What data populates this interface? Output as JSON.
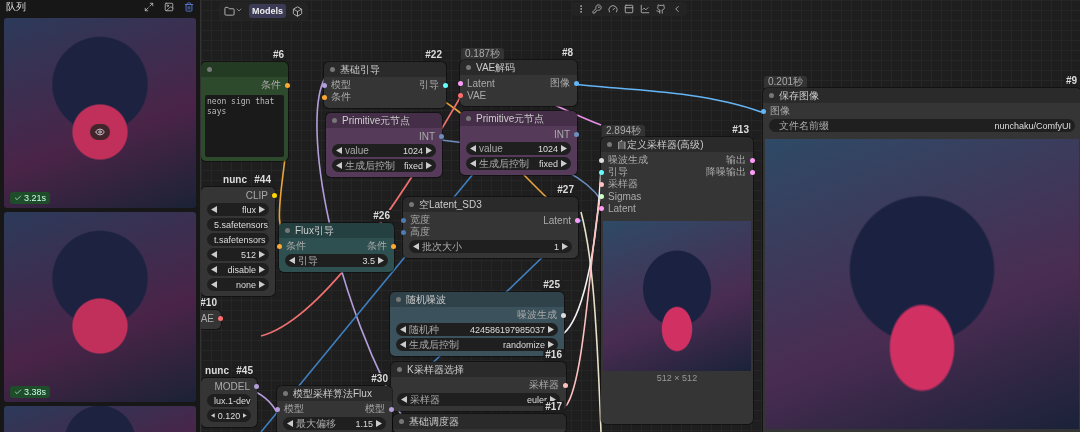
{
  "queue_panel": {
    "title": "队列",
    "items": [
      {
        "duration": "3.21s",
        "preview_button": true
      },
      {
        "duration": "3.38s",
        "preview_button": false
      },
      {
        "preview_button": false
      }
    ]
  },
  "toolbar": {
    "models_label": "Models"
  },
  "nodes": [
    {
      "id": "#6",
      "color": "#2e4a2c",
      "header": true,
      "outputs": [
        {
          "label": "条件",
          "color": "#ffa931"
        }
      ],
      "prompt": "neon sign that says"
    },
    {
      "id": "#22",
      "title": "基础引导",
      "color": "#353535",
      "header": true,
      "inputs": [
        {
          "label": "模型",
          "color": "#b39ddb"
        },
        {
          "label": "条件",
          "color": "#ffa931"
        }
      ],
      "outputs": [
        {
          "label": "引导",
          "color": "#66ffff"
        }
      ]
    },
    {
      "id": "#8",
      "title": "VAE解码",
      "time": "0.187秒",
      "color": "#353535",
      "header": true,
      "inputs": [
        {
          "label": "Latent",
          "color": "#ff9cf9"
        },
        {
          "label": "VAE",
          "color": "#ff6e6e"
        }
      ],
      "outputs": [
        {
          "label": "图像",
          "color": "#64b5f6"
        }
      ]
    },
    {
      "title": "Primitive元节点",
      "color": "#553a5a",
      "header": true,
      "outputs": [
        {
          "label": "INT",
          "color": "#6c8ebf"
        }
      ],
      "widgets": [
        {
          "kind": "stepper",
          "label": "value",
          "value": "1024"
        },
        {
          "kind": "stepper",
          "label": "生成后控制",
          "value": "fixed"
        }
      ]
    },
    {
      "title": "Primitive元节点",
      "color": "#553a5a",
      "header": true,
      "outputs": [
        {
          "label": "INT",
          "color": "#6c8ebf"
        }
      ],
      "widgets": [
        {
          "kind": "stepper",
          "label": "value",
          "value": "1024"
        },
        {
          "kind": "stepper",
          "label": "生成后控制",
          "value": "fixed"
        }
      ]
    },
    {
      "id": "#44",
      "caption": "nunc",
      "color": "#353535",
      "header": false,
      "outputs": [
        {
          "label": "CLIP",
          "color": "#ffd500"
        }
      ],
      "widgets": [
        {
          "kind": "stepper",
          "value": "flux"
        },
        {
          "kind": "stepper",
          "value": "5.safetensors"
        },
        {
          "kind": "stepper",
          "value": "t.safetensors"
        },
        {
          "kind": "stepper",
          "value": "512"
        },
        {
          "kind": "stepper",
          "value": "disable"
        },
        {
          "kind": "stepper",
          "value": "none"
        }
      ]
    },
    {
      "id": "#27",
      "title": "空Latent_SD3",
      "color": "#353535",
      "header": true,
      "inputs": [
        {
          "label": "宽度",
          "color": "#4e7ab5"
        },
        {
          "label": "高度",
          "color": "#4e7ab5"
        }
      ],
      "outputs": [
        {
          "label": "Latent",
          "color": "#ff9cf9"
        }
      ],
      "widgets": [
        {
          "kind": "stepper",
          "label": "批次大小",
          "value": "1"
        }
      ]
    },
    {
      "id": "#26",
      "title": "Flux引导",
      "color": "#2f5050",
      "header": true,
      "inputs": [
        {
          "label": "条件",
          "color": "#ffa931"
        }
      ],
      "outputs": [
        {
          "label": "条件",
          "color": "#ffa931"
        }
      ],
      "widgets": [
        {
          "kind": "stepper",
          "label": "引导",
          "value": "3.5"
        }
      ]
    },
    {
      "id": "#13",
      "title": "自定义采样器(高级)",
      "time": "2.894秒",
      "color": "#353535",
      "header": true,
      "inputs": [
        {
          "label": "噪波生成",
          "color": "#dddddd"
        },
        {
          "label": "引导",
          "color": "#66ffff"
        },
        {
          "label": "采样器",
          "color": "#ffc0c0"
        },
        {
          "label": "Sigmas",
          "color": "#cdffcd"
        },
        {
          "label": "Latent",
          "color": "#ff9cf9"
        }
      ],
      "outputs": [
        {
          "label": "输出",
          "color": "#ff9cf9"
        },
        {
          "label": "降噪输出",
          "color": "#ff9cf9"
        }
      ],
      "image": true,
      "image_caption": "512 × 512"
    },
    {
      "id": "#9",
      "title": "保存图像",
      "time": "0.201秒",
      "color": "#353535",
      "header": true,
      "inputs": [
        {
          "label": "图像",
          "color": "#64b5f6"
        }
      ],
      "widgets": [
        {
          "kind": "text",
          "label": "文件名前缀",
          "value": "nunchaku/ComfyUI"
        }
      ],
      "image": true
    },
    {
      "id": "#10",
      "color": "#353535",
      "header": false,
      "outputs": [
        {
          "label": "AE",
          "color": "#ff6e6e"
        }
      ]
    },
    {
      "id": "#25",
      "title": "随机噪波",
      "color": "#3b525c",
      "header": true,
      "outputs": [
        {
          "label": "噪波生成",
          "color": "#dddddd"
        }
      ],
      "widgets": [
        {
          "kind": "stepper",
          "label": "随机种",
          "value": "424586197985037"
        },
        {
          "kind": "stepper",
          "label": "生成后控制",
          "value": "randomize"
        }
      ]
    },
    {
      "id": "#16",
      "title": "K采样器选择",
      "color": "#353535",
      "header": true,
      "outputs": [
        {
          "label": "采样器",
          "color": "#ffc0c0"
        }
      ],
      "widgets": [
        {
          "kind": "stepper",
          "label": "采样器",
          "value": "euler"
        }
      ]
    },
    {
      "id": "#45",
      "caption": "nunc",
      "color": "#353535",
      "header": false,
      "outputs": [
        {
          "label": "MODEL",
          "color": "#b39ddb"
        }
      ],
      "widgets": [
        {
          "kind": "stepper",
          "value": "lux.1-dev"
        },
        {
          "kind": "stepper",
          "value": "0.120"
        }
      ]
    },
    {
      "id": "#30",
      "title": "模型采样算法Flux",
      "color": "#353535",
      "header": true,
      "inputs": [
        {
          "label": "模型",
          "color": "#b39ddb"
        }
      ],
      "outputs": [
        {
          "label": "模型",
          "color": "#b39ddb"
        }
      ],
      "widgets": [
        {
          "kind": "stepper",
          "label": "最大偏移",
          "value": "1.15"
        }
      ]
    },
    {
      "id": "#17",
      "title": "基础调度器",
      "color": "#353535",
      "header": true
    }
  ]
}
